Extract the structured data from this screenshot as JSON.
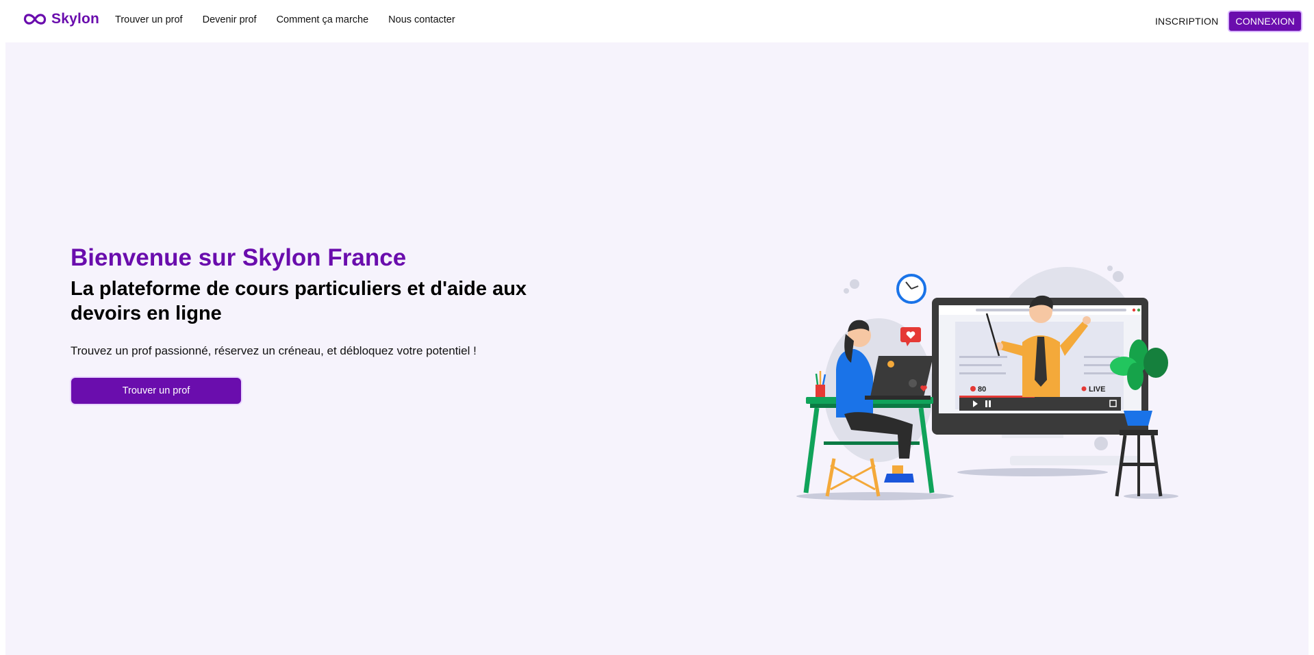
{
  "brand": {
    "name": "Skylon",
    "icon": "infinity-icon",
    "color": "#6a0dad"
  },
  "nav": {
    "items": [
      {
        "label": "Trouver un prof"
      },
      {
        "label": "Devenir prof"
      },
      {
        "label": "Comment ça marche"
      },
      {
        "label": "Nous contacter"
      }
    ]
  },
  "auth": {
    "register_label": "INSCRIPTION",
    "login_label": "CONNEXION"
  },
  "hero": {
    "title": "Bienvenue sur Skylon France",
    "subtitle": "La plateforme de cours particuliers et d'aide aux devoirs en ligne",
    "description": "Trouvez un prof passionné, réservez un créneau, et débloquez votre potentiel !",
    "cta_label": "Trouver un prof"
  },
  "illustration": {
    "viewer_count": "80",
    "live_label": "LIVE"
  },
  "colors": {
    "accent": "#6a0dad",
    "hero_bg": "#f6f3fc"
  }
}
